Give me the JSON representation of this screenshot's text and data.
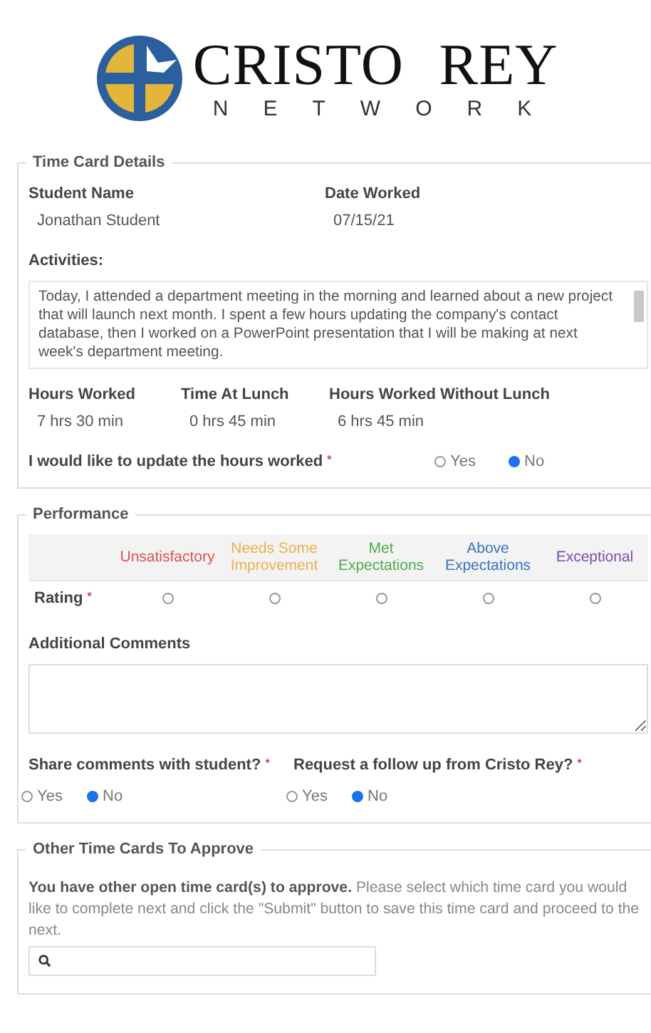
{
  "logo": {
    "name": "CRISTO REY",
    "subtitle": "NETWORK"
  },
  "time_card_details": {
    "legend": "Time Card Details",
    "student_name": {
      "label": "Student Name",
      "value": "Jonathan Student"
    },
    "date_worked": {
      "label": "Date Worked",
      "value": "07/15/21"
    },
    "activities": {
      "label": "Activities:",
      "value": "Today, I attended a department meeting in the morning and learned about a new project that will launch next month. I spent a few hours updating the company's contact database, then I worked on a PowerPoint presentation that I will be making at next week's department meeting."
    },
    "hours": [
      {
        "label": "Hours Worked",
        "value": "7 hrs 30 min"
      },
      {
        "label": "Time At Lunch",
        "value": "0 hrs 45 min"
      },
      {
        "label": "Hours Worked Without Lunch",
        "value": "6 hrs 45 min"
      }
    ],
    "update_hours": {
      "label": "I would like to update the hours worked",
      "required_mark": "*",
      "options": [
        {
          "label": "Yes",
          "selected": false
        },
        {
          "label": "No",
          "selected": true
        }
      ]
    }
  },
  "performance": {
    "legend": "Performance",
    "rating": {
      "label": "Rating",
      "required_mark": "*",
      "options": [
        {
          "label": "Unsatisfactory",
          "color": "#d9534f",
          "selected": false
        },
        {
          "label": "Needs Some Improvement",
          "color": "#f0ad4e",
          "selected": false
        },
        {
          "label": "Met Expectations",
          "color": "#4cae4c",
          "selected": false
        },
        {
          "label": "Above Expectations",
          "color": "#3a74c0",
          "selected": false
        },
        {
          "label": "Exceptional",
          "color": "#7b4fa8",
          "selected": false
        }
      ]
    },
    "additional_comments": {
      "label": "Additional Comments"
    },
    "questions": [
      {
        "label": "Share comments with student?",
        "required_mark": "*",
        "options": [
          {
            "label": "Yes",
            "selected": false
          },
          {
            "label": "No",
            "selected": true
          }
        ]
      },
      {
        "label": "Request a follow up from Cristo Rey?",
        "required_mark": "*",
        "options": [
          {
            "label": "Yes",
            "selected": false
          },
          {
            "label": "No",
            "selected": true
          }
        ]
      }
    ]
  },
  "other_time_cards": {
    "legend": "Other Time Cards To Approve",
    "message": "**You have other open time card(s) to approve.** Please select which time card you would like to complete next and click the \"Submit\" button to save this time card and proceed to the next."
  }
}
